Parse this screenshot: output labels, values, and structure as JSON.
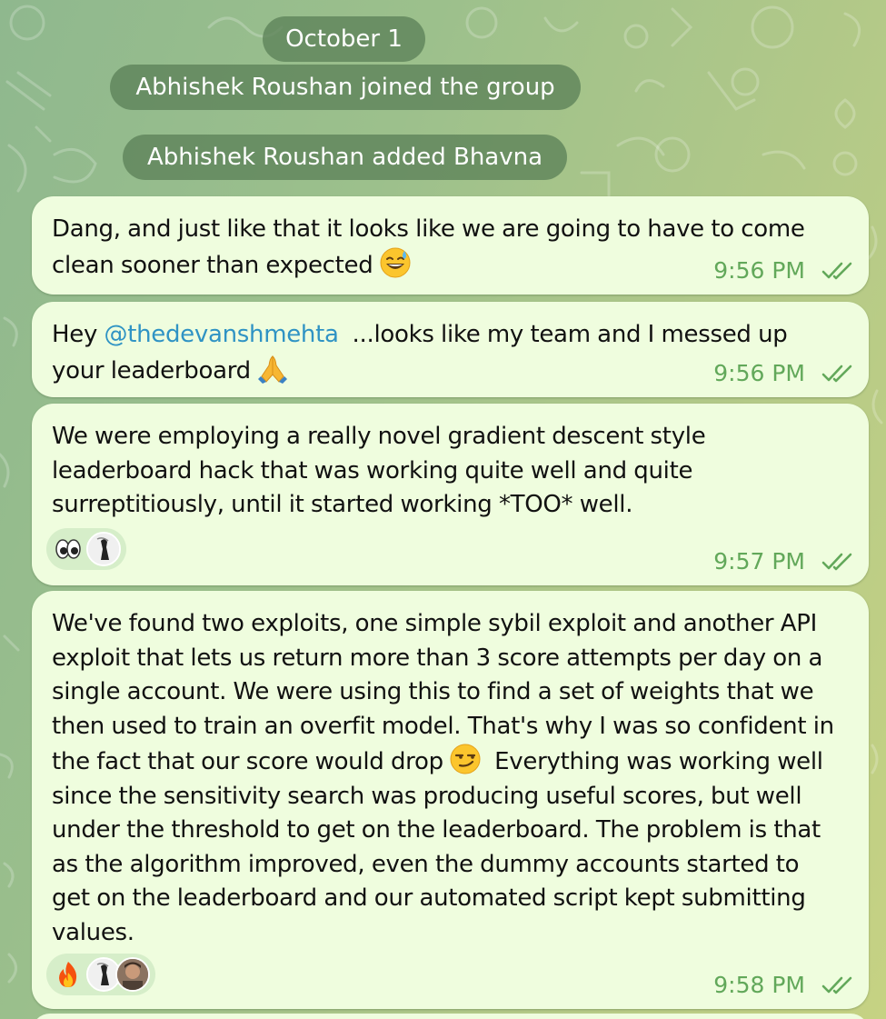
{
  "colors": {
    "bubble": "#effdde",
    "service_pill": "#5c8258",
    "meta_green": "#62a85a",
    "mention": "#2f93c4"
  },
  "service": {
    "date": "October 1",
    "joined": "Abhishek Roushan joined the group",
    "added": "Abhishek Roushan added Bhavna"
  },
  "messages": [
    {
      "text": "Dang, and just like that it looks like we are going to have to come\nclean sooner than expected ",
      "emoji": "grinning-sweat",
      "time": "9:56 PM",
      "status": "read"
    },
    {
      "prefix": "Hey ",
      "mention": "@thedevanshmehta",
      "text_after": "  ...looks like my team and I messed up\nyour leaderboard ",
      "emoji": "folded-hands",
      "time": "9:56 PM",
      "status": "read"
    },
    {
      "text": "We were employing a really novel gradient descent style\nleaderboard hack that was working quite well and quite\nsurreptitiously, until it started working *TOO* well.",
      "reactions": [
        "eyes"
      ],
      "reaction_avatars": 1,
      "time": "9:57 PM",
      "status": "read"
    },
    {
      "text_before": "We've found two exploits, one simple sybil exploit and another API\nexploit that lets us return more than 3 score attempts per day on a\nsingle account. We were using this to find a set of weights that we\nthen used to train an overfit model. That's why I was so confident in\nthe fact that our score would drop ",
      "emoji": "smirking-face",
      "text_after": "  Everything was working well\nsince the sensitivity search was producing useful scores, but well\nunder the threshold to get on the leaderboard. The problem is that\nas the algorithm improved, even the dummy accounts started to\nget on the leaderboard and our automated script kept submitting\nvalues.",
      "reactions": [
        "fire"
      ],
      "reaction_avatars": 2,
      "time": "9:58 PM",
      "status": "read"
    }
  ]
}
